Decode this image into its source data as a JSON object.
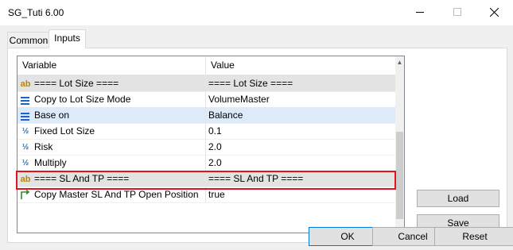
{
  "window": {
    "title": "SG_Tuti 6.00"
  },
  "tabs": [
    {
      "label": "Common"
    },
    {
      "label": "Inputs"
    }
  ],
  "table": {
    "headers": {
      "variable": "Variable",
      "value": "Value"
    },
    "rows": [
      {
        "icon": "ab",
        "variable": "==== Lot Size ====",
        "value": "==== Lot Size ====",
        "type": "section"
      },
      {
        "icon": "enum",
        "variable": "Copy to Lot Size Mode",
        "value": "VolumeMaster",
        "type": "normal"
      },
      {
        "icon": "enum",
        "variable": "Base on",
        "value": "Balance",
        "type": "selected"
      },
      {
        "icon": "half",
        "variable": "Fixed Lot Size",
        "value": "0.1",
        "type": "normal"
      },
      {
        "icon": "half",
        "variable": "Risk",
        "value": "2.0",
        "type": "normal"
      },
      {
        "icon": "half",
        "variable": "Multiply",
        "value": "2.0",
        "type": "highlighted"
      },
      {
        "icon": "ab",
        "variable": "==== SL And TP ====",
        "value": "==== SL And TP ====",
        "type": "section"
      },
      {
        "icon": "arrow",
        "variable": "Copy Master SL And TP Open Position",
        "value": "true",
        "type": "normal"
      }
    ]
  },
  "buttons": {
    "load": "Load",
    "save": "Save",
    "ok": "OK",
    "cancel": "Cancel",
    "reset": "Reset"
  },
  "colors": {
    "highlight_border": "#e0141e",
    "selected_row": "#ddeafa",
    "section_row": "#e3e3e3"
  }
}
